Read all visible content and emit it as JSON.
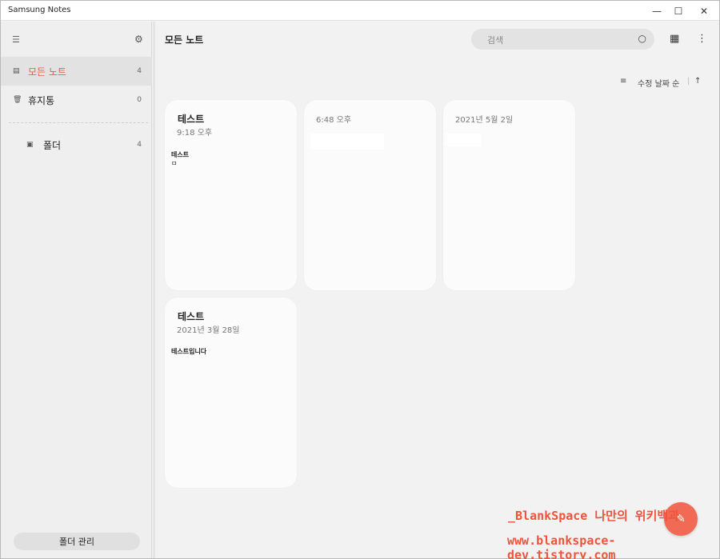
{
  "window": {
    "title": "Samsung Notes"
  },
  "window_controls": {
    "minimize": "—",
    "maximize": "☐",
    "close": "✕"
  },
  "sidebar": {
    "menu_icon": "☰",
    "settings_icon": "⚙",
    "items": [
      {
        "label": "모든 노트",
        "count": "4",
        "icon": "▤"
      },
      {
        "label": "휴지통",
        "count": "0",
        "icon": "🗑"
      }
    ],
    "folders": [
      {
        "label": "폴더",
        "count": "4",
        "icon": "▣"
      }
    ],
    "manage_button": "폴더 관리"
  },
  "header": {
    "title": "모든 노트",
    "search_placeholder": "검색",
    "search_icon": "○",
    "pdf_icon": "▦",
    "more_icon": "⋮"
  },
  "sort": {
    "icon": "≡",
    "label": "수정 날짜 순",
    "direction_icon": "↑"
  },
  "notes": [
    {
      "title": "테스트",
      "date": "9:18 오후",
      "body_line1": "테스트",
      "body_line2": "ㅁ"
    },
    {
      "title": "",
      "date": "6:48 오후",
      "body_line1": "",
      "body_line2": ""
    },
    {
      "title": "",
      "date": "2021년 5월 2일",
      "body_line1": "",
      "body_line2": ""
    },
    {
      "title": "테스트",
      "date": "2021년 3월 28일",
      "body_line1": "테스트입니다",
      "body_line2": ""
    }
  ],
  "fab": {
    "icon": "✎"
  },
  "watermark": {
    "line1": "_BlankSpace 나만의 위키백과",
    "line2": "www.blankspace-dev.tistory.com"
  }
}
